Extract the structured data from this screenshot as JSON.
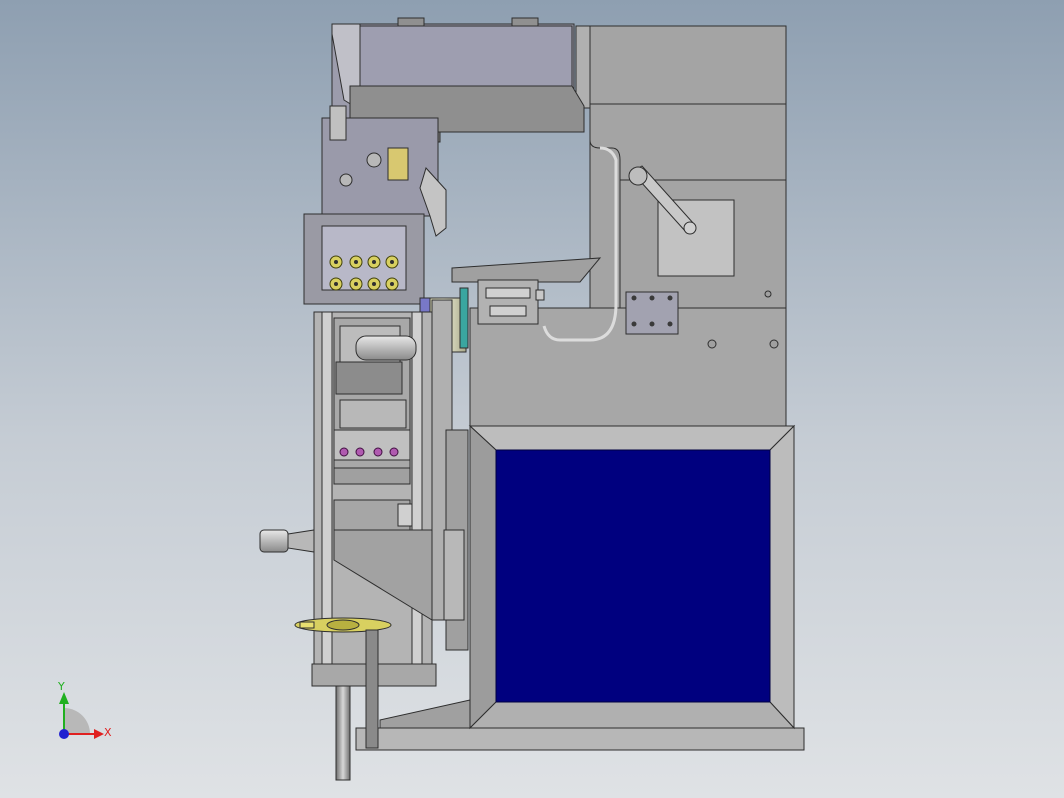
{
  "viewport": {
    "background_top": "#8e9fb1",
    "background_bottom": "#dfe2e5"
  },
  "model": {
    "panel_color": "#00007f",
    "body_color": "#a3a3a3",
    "frame_color": "#b4b4b4",
    "highlight_color": "#d8d060",
    "nozzle_color": "#b05ab0"
  },
  "triad": {
    "x_label": "X",
    "y_label": "Y",
    "x_color": "#e02020",
    "y_color": "#20b020",
    "z_color": "#2020d0"
  }
}
